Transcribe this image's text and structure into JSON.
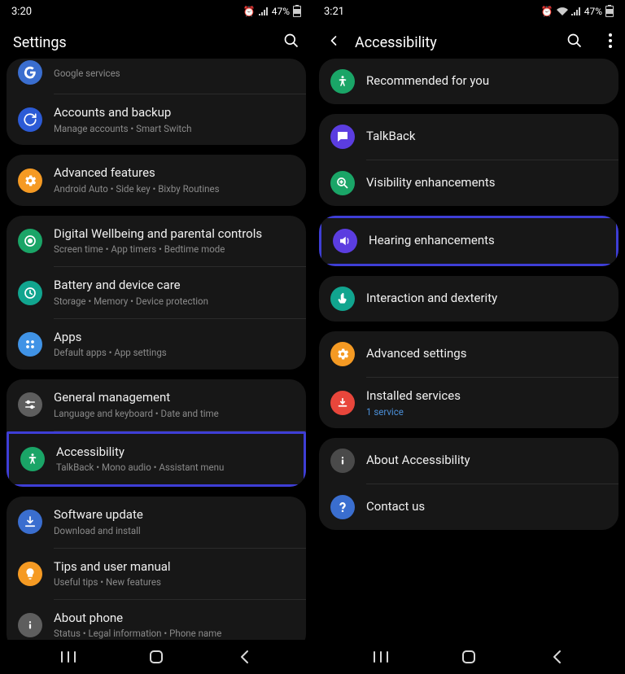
{
  "left": {
    "time": "3:20",
    "battery": "47%",
    "header": "Settings",
    "items": {
      "google": {
        "sub": "Google services"
      },
      "accounts": {
        "title": "Accounts and backup",
        "sub": "Manage accounts  •  Smart Switch"
      },
      "advanced": {
        "title": "Advanced features",
        "sub": "Android Auto  •  Side key  •  Bixby Routines"
      },
      "wellbeing": {
        "title": "Digital Wellbeing and parental controls",
        "sub": "Screen time  •  App timers  •  Bedtime mode"
      },
      "battery": {
        "title": "Battery and device care",
        "sub": "Storage  •  Memory  •  Device protection"
      },
      "apps": {
        "title": "Apps",
        "sub": "Default apps  •  App settings"
      },
      "general": {
        "title": "General management",
        "sub": "Language and keyboard  •  Date and time"
      },
      "accessibility": {
        "title": "Accessibility",
        "sub": "TalkBack  •  Mono audio  •  Assistant menu"
      },
      "update": {
        "title": "Software update",
        "sub": "Download and install"
      },
      "tips": {
        "title": "Tips and user manual",
        "sub": "Useful tips  •  New features"
      },
      "about": {
        "title": "About phone",
        "sub": "Status  •  Legal information  •  Phone name"
      }
    }
  },
  "right": {
    "time": "3:21",
    "battery": "47%",
    "header": "Accessibility",
    "items": {
      "recommended": {
        "title": "Recommended for you"
      },
      "talkback": {
        "title": "TalkBack"
      },
      "visibility": {
        "title": "Visibility enhancements"
      },
      "hearing": {
        "title": "Hearing enhancements"
      },
      "interaction": {
        "title": "Interaction and dexterity"
      },
      "advanced": {
        "title": "Advanced settings"
      },
      "installed": {
        "title": "Installed services",
        "sub": "1 service"
      },
      "about": {
        "title": "About Accessibility"
      },
      "contact": {
        "title": "Contact us"
      }
    }
  },
  "iconColors": {
    "blue": "#3a6ecf",
    "sync": "#2c5bd6",
    "orange": "#f59a23",
    "green": "#1aa567",
    "teal": "#11a58f",
    "lightblue": "#4093e6",
    "grey": "#5e5e5e",
    "violet": "#5b3de0",
    "red": "#e8463b",
    "darkgrey": "#4a4a4a",
    "help": "#3a6ecf"
  }
}
